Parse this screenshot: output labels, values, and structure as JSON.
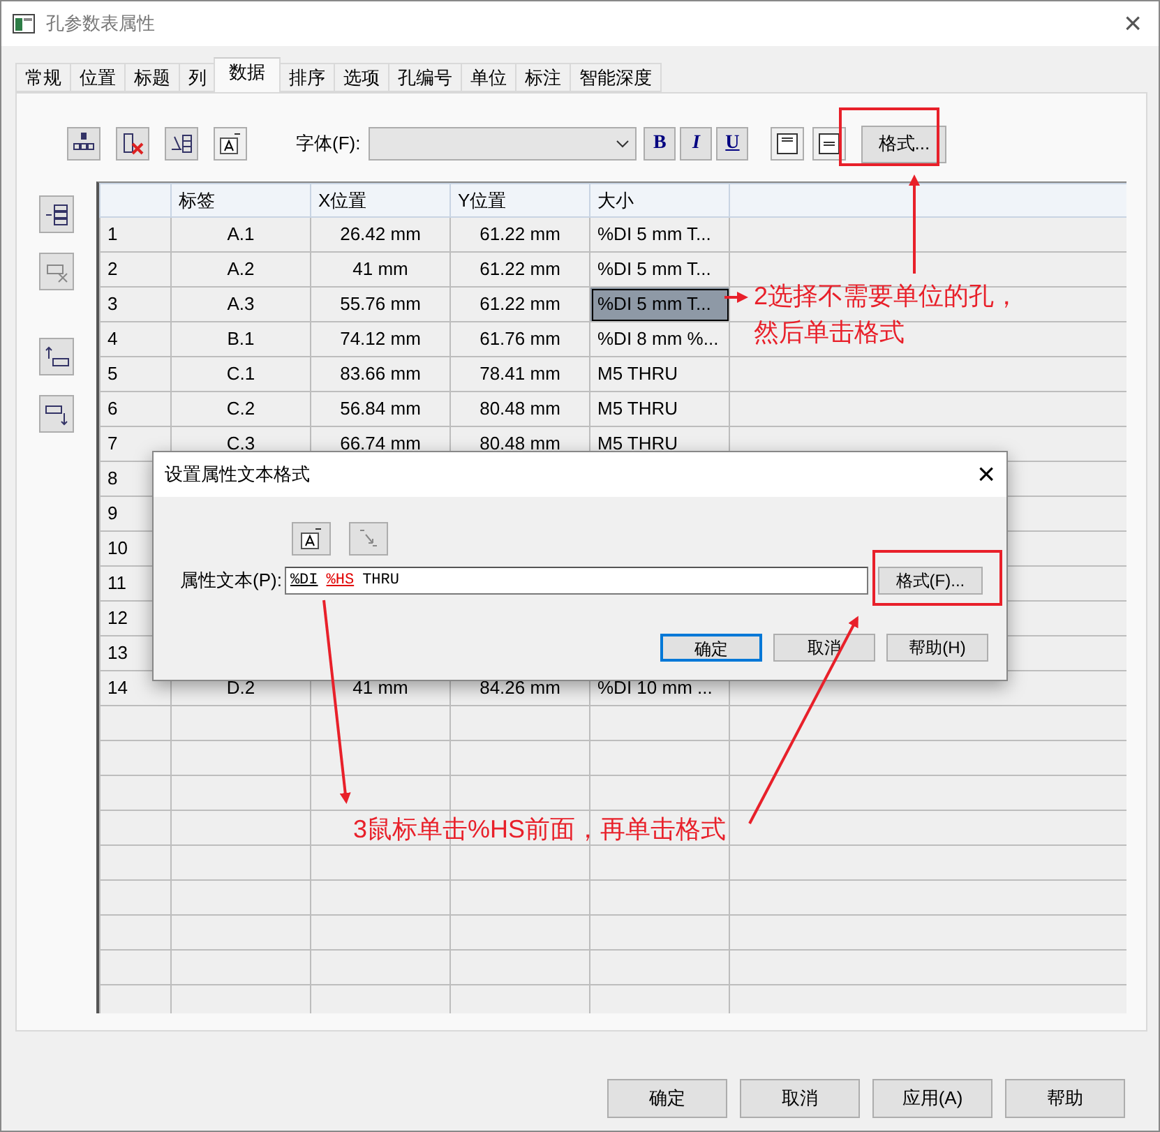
{
  "window": {
    "title": "孔参数表属性",
    "close": "×"
  },
  "tabs": [
    {
      "label": "常规",
      "selected": false
    },
    {
      "label": "位置",
      "selected": false
    },
    {
      "label": "标题",
      "selected": false
    },
    {
      "label": "列",
      "selected": false
    },
    {
      "label": "数据",
      "selected": true
    },
    {
      "label": "排序",
      "selected": false
    },
    {
      "label": "选项",
      "selected": false
    },
    {
      "label": "孔编号",
      "selected": false
    },
    {
      "label": "单位",
      "selected": false
    },
    {
      "label": "标注",
      "selected": false
    },
    {
      "label": "智能深度",
      "selected": false
    }
  ],
  "toolbar": {
    "font_label": "字体(F):",
    "bold": "B",
    "italic": "I",
    "underline": "U",
    "format_button": "格式..."
  },
  "table": {
    "columns": [
      "",
      "标签",
      "X位置",
      "Y位置",
      "大小"
    ],
    "rows": [
      {
        "no": "1",
        "label": "A.1",
        "x": "26.42 mm",
        "y": "61.22 mm",
        "size": "%DI 5 mm T...",
        "selected": false
      },
      {
        "no": "2",
        "label": "A.2",
        "x": "41 mm",
        "y": "61.22 mm",
        "size": "%DI 5 mm T...",
        "selected": false
      },
      {
        "no": "3",
        "label": "A.3",
        "x": "55.76 mm",
        "y": "61.22 mm",
        "size": "%DI 5 mm T...",
        "selected": true
      },
      {
        "no": "4",
        "label": "B.1",
        "x": "74.12 mm",
        "y": "61.76 mm",
        "size": "%DI 8 mm %...",
        "selected": false
      },
      {
        "no": "5",
        "label": "C.1",
        "x": "83.66 mm",
        "y": "78.41 mm",
        "size": "M5 THRU",
        "selected": false
      },
      {
        "no": "6",
        "label": "C.2",
        "x": "56.84 mm",
        "y": "80.48 mm",
        "size": "M5 THRU",
        "selected": false
      },
      {
        "no": "7",
        "label": "C.3",
        "x": "66.74 mm",
        "y": "80.48 mm",
        "size": "M5 THRU",
        "selected": false
      },
      {
        "no": "8"
      },
      {
        "no": "9"
      },
      {
        "no": "10"
      },
      {
        "no": "11"
      },
      {
        "no": "12"
      },
      {
        "no": "13"
      },
      {
        "no": "14",
        "label": "D.2",
        "x": "41 mm",
        "y": "84.26 mm",
        "size": "%DI 10 mm ...",
        "selected": false
      }
    ]
  },
  "buttons": [
    "确定",
    "取消",
    "应用(A)",
    "帮助"
  ],
  "dialog": {
    "title": "设置属性文本格式",
    "close": "×",
    "field_label": "属性文本(P):",
    "field_value": [
      {
        "text": "%DI",
        "kind": "code",
        "highlighted": false
      },
      {
        "text": "%HS",
        "kind": "code",
        "highlighted": true
      },
      {
        "text": "THRU",
        "kind": "plain",
        "highlighted": false
      }
    ],
    "format_button": "格式(F)...",
    "buttons": [
      {
        "label": "确定",
        "focused": true
      },
      {
        "label": "取消",
        "focused": false
      },
      {
        "label": "帮助(H)",
        "focused": false
      }
    ]
  },
  "annotations": [
    {
      "text": "2选择不需要单位的孔，然后单击格式"
    },
    {
      "text": "3鼠标单击%HS前面，再单击格式"
    }
  ]
}
